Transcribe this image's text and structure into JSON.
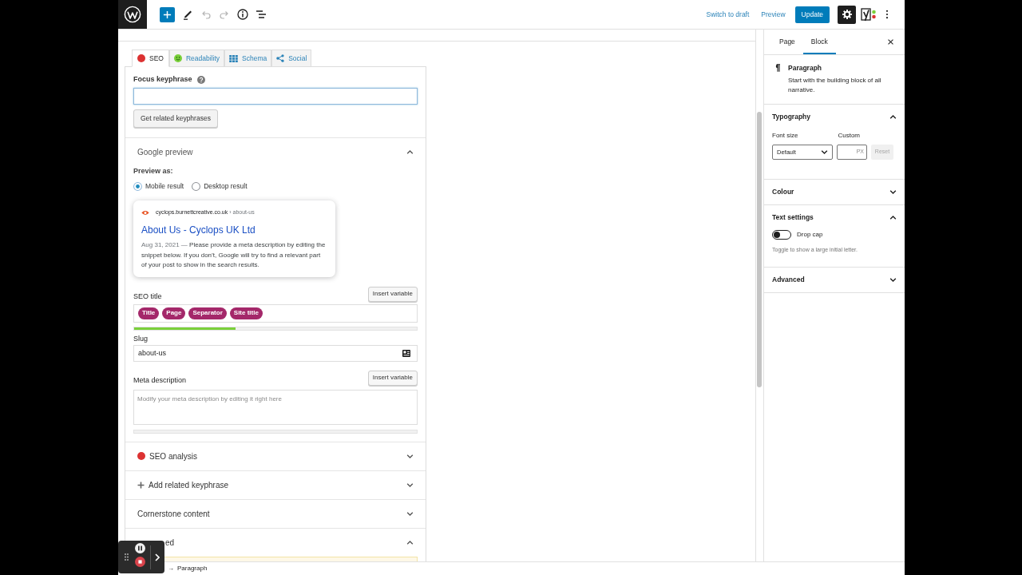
{
  "toolbar": {
    "tools": [
      {
        "kind": "inserter",
        "disabled": false
      },
      {
        "kind": "edit",
        "disabled": false
      },
      {
        "kind": "undo",
        "disabled": true
      },
      {
        "kind": "redo",
        "disabled": true
      },
      {
        "kind": "details",
        "disabled": false
      },
      {
        "kind": "list_view",
        "disabled": false
      }
    ],
    "switch_to_draft": "Switch to draft",
    "preview": "Preview",
    "update": "Update",
    "settings_pressed": true
  },
  "metabox": {
    "tabs": [
      {
        "label": "SEO",
        "kind": "score",
        "color": "#dc3232",
        "selected": true
      },
      {
        "label": "Readability",
        "kind": "smiley",
        "color": "#7ad03a",
        "selected": false
      },
      {
        "label": "Schema",
        "kind": "grid",
        "selected": false
      },
      {
        "label": "Social",
        "kind": "share",
        "selected": false
      }
    ],
    "focus_keyphrase": {
      "label": "Focus keyphrase",
      "focused": true
    },
    "related_button": "Get related keyphrases",
    "google_preview": {
      "title": "Google preview",
      "expanded": true,
      "preview_as": "Preview as:",
      "modes": [
        {
          "label": "Mobile result",
          "selected": true
        },
        {
          "label": "Desktop result",
          "selected": false
        }
      ],
      "result": {
        "url": "cyclops.burnettcreative.co.uk",
        "path": "› about-us",
        "title": "About Us - Cyclops UK Ltd",
        "date": "Aug 31, 2021",
        "separator": "—",
        "description": "Please provide a meta description by editing the snippet below. If you don’t, Google will try to find a relevant part of your post to show in the search results."
      }
    },
    "seo_title": {
      "label": "SEO title",
      "insert_button": "Insert variable",
      "variables": [
        "Title",
        "Page",
        "Separator",
        "Site title"
      ],
      "length_meter": {
        "level": 0.36
      }
    },
    "slug": {
      "label": "Slug",
      "value": "about-us"
    },
    "meta_description": {
      "label": "Meta description",
      "insert_button": "Insert variable",
      "placeholder": "Modify your meta description by editing it right here",
      "length_meter": {
        "level": 0
      }
    },
    "sections": [
      {
        "title": "SEO analysis",
        "kind": "score",
        "color": "#dc3232",
        "expanded": false
      },
      {
        "title": "Add related keyphrase",
        "kind": "add",
        "expanded": false
      },
      {
        "title": "Cornerstone content",
        "kind": "plain",
        "expanded": false
      },
      {
        "title": "ed",
        "kind": "occluded",
        "expanded": true
      }
    ]
  },
  "breadcrumb": {
    "separator": "→",
    "current": "Paragraph"
  },
  "sidebar": {
    "tabs": [
      {
        "label": "Page",
        "selected": false
      },
      {
        "label": "Block",
        "selected": true
      }
    ],
    "block": {
      "name": "Paragraph",
      "description": "Start with the building block of all narrative."
    },
    "panels": [
      {
        "title": "Typography",
        "kind": "typography",
        "expanded": true,
        "font_size_label": "Font size",
        "select_value": "Default",
        "custom_label": "Custom",
        "unit": "PX",
        "reset": "Reset",
        "reset_disabled": true
      },
      {
        "title": "Colour",
        "kind": "plain",
        "expanded": false
      },
      {
        "title": "Text settings",
        "kind": "text_settings",
        "expanded": true,
        "toggle_label": "Drop cap",
        "on": false,
        "help": "Toggle to show a large initial letter."
      },
      {
        "title": "Advanced",
        "kind": "plain",
        "expanded": false
      }
    ]
  }
}
